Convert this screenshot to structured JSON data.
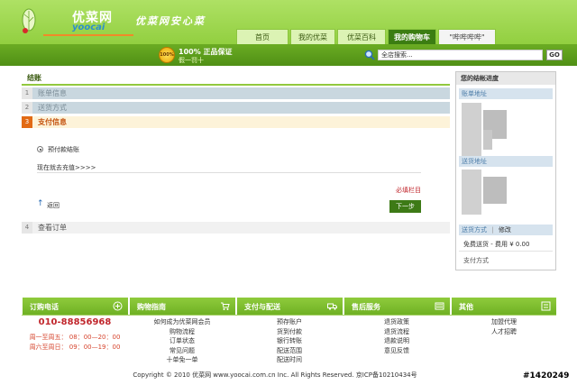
{
  "header": {
    "logo_cn": "优菜网",
    "logo_en": "yoocai",
    "slogan": "优菜网安心菜",
    "nav": [
      {
        "label": "首页"
      },
      {
        "label": "我的优菜"
      },
      {
        "label": "优菜百科"
      },
      {
        "label": "我的购物车"
      },
      {
        "label": "\"哔哔哔哔\""
      }
    ],
    "active_nav": "我的购物车"
  },
  "promo": {
    "badge": "100%",
    "line1": "100% 正品保证",
    "line2": "假一罚十"
  },
  "search": {
    "value": "全店搜索...",
    "button": "GO"
  },
  "checkout": {
    "title": "结账",
    "steps": [
      {
        "num": "1",
        "label": "账单信息",
        "state": "done"
      },
      {
        "num": "2",
        "label": "送货方式",
        "state": "done"
      },
      {
        "num": "3",
        "label": "支付信息",
        "state": "current"
      },
      {
        "num": "4",
        "label": "查看订单",
        "state": "later"
      }
    ],
    "payment_option": "预付款结账",
    "recharge_link": "现在就去充值>>>>",
    "required_note": "必填栏目",
    "back_label": "返回",
    "next_label": "下一步"
  },
  "progress": {
    "title": "您的结帐进度",
    "billing_label": "账单地址",
    "shipping_label": "送货地址",
    "ship_method_label": "送货方式",
    "divider": "|",
    "edit_label": "修改",
    "ship_method_value": "免费送货 - 费用 ¥ 0.00",
    "payment_label": "支付方式"
  },
  "footer": {
    "columns": [
      {
        "title": "订购电话",
        "icon": "phone-icon"
      },
      {
        "title": "购物指南",
        "icon": "cart-icon",
        "links": [
          "如何成为优菜网会员",
          "购物流程",
          "订单状态",
          "常见问题",
          "十单免一单"
        ]
      },
      {
        "title": "支付与配送",
        "icon": "truck-icon",
        "links": [
          "预存账户",
          "货到付款",
          "银行转账",
          "配送范围",
          "配送时间"
        ]
      },
      {
        "title": "售后服务",
        "icon": "service-icon",
        "links": [
          "退货政策",
          "退货流程",
          "退款说明",
          "意见反馈"
        ]
      },
      {
        "title": "其他",
        "icon": "other-icon",
        "links": [
          "加盟代理",
          "人才招聘"
        ]
      }
    ],
    "phone": "010-88856968",
    "hours": [
      "周一至周五： 08：00—20：00",
      "周六至周日： 09：00—19：00"
    ],
    "copyright": "Copyright © 2010 优菜网 www.yoocai.com.cn Inc. All Rights Reserved. 京ICP备10210434号",
    "watermark": "#1420249"
  },
  "colors": {
    "brand_green": "#92cf40",
    "dark_green": "#3d7a16",
    "accent_orange": "#e26a14",
    "alert_red": "#c1272d"
  }
}
